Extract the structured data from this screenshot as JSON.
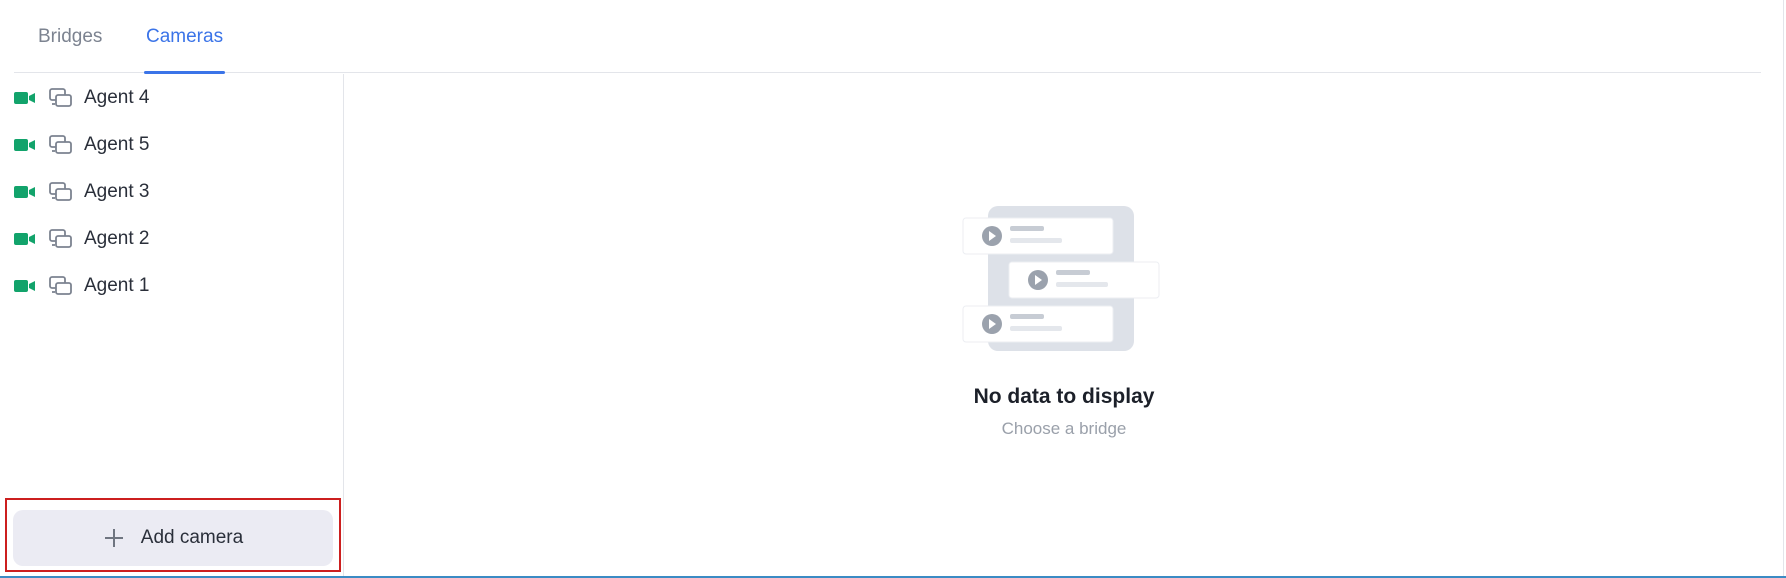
{
  "tabs": [
    {
      "label": "Bridges",
      "active": false
    },
    {
      "label": "Cameras",
      "active": true
    }
  ],
  "sidebar": {
    "items": [
      {
        "label": "Agent 4",
        "status_icon": "video-camera-icon",
        "type_icon": "agent-devices-icon",
        "status_color": "#12a36b"
      },
      {
        "label": "Agent 5",
        "status_icon": "video-camera-icon",
        "type_icon": "agent-devices-icon",
        "status_color": "#12a36b"
      },
      {
        "label": "Agent 3",
        "status_icon": "video-camera-icon",
        "type_icon": "agent-devices-icon",
        "status_color": "#12a36b"
      },
      {
        "label": "Agent 2",
        "status_icon": "video-camera-icon",
        "type_icon": "agent-devices-icon",
        "status_color": "#12a36b"
      },
      {
        "label": "Agent 1",
        "status_icon": "video-camera-icon",
        "type_icon": "agent-devices-icon",
        "status_color": "#12a36b"
      }
    ],
    "add_button": {
      "label": "Add camera",
      "icon": "plus-icon"
    }
  },
  "main": {
    "empty_state": {
      "title": "No data to display",
      "subtitle": "Choose a bridge",
      "icon": "video-list-illustration"
    }
  },
  "colors": {
    "accent": "#3b74e8",
    "status_online": "#12a36b",
    "highlight_border": "#cc1f1f",
    "button_bg": "#ebebf3"
  }
}
